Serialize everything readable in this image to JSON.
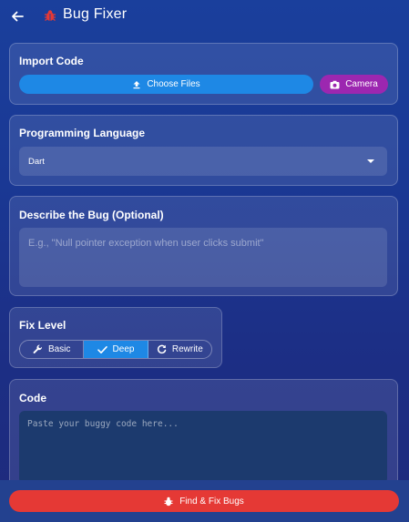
{
  "header": {
    "title": "Bug Fixer",
    "back_icon": "arrow-left-icon",
    "logo_icon": "bug-icon",
    "logo_color": "#e53935"
  },
  "import": {
    "title": "Import Code",
    "choose_label": "Choose Files",
    "choose_icon": "upload-icon",
    "camera_label": "Camera",
    "camera_icon": "camera-icon"
  },
  "language": {
    "title": "Programming Language",
    "selected": "Dart"
  },
  "describe": {
    "title": "Describe the Bug (Optional)",
    "placeholder": "E.g., \"Null pointer exception when user clicks submit\""
  },
  "fix_level": {
    "title": "Fix Level",
    "options": [
      {
        "label": "Basic",
        "icon": "wrench-icon"
      },
      {
        "label": "Deep",
        "icon": "check-icon"
      },
      {
        "label": "Rewrite",
        "icon": "refresh-icon"
      }
    ],
    "selected": "Deep"
  },
  "code": {
    "title": "Code",
    "placeholder": "Paste your buggy code here..."
  },
  "action": {
    "label": "Find & Fix Bugs",
    "icon": "bug-icon"
  },
  "colors": {
    "primary": "#1e88e5",
    "camera": "#9c27b0",
    "danger": "#e53935"
  }
}
